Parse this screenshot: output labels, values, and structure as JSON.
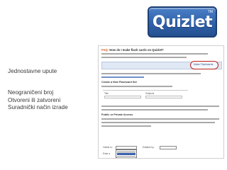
{
  "logo": {
    "text": "Quizlet",
    "tm": "TM"
  },
  "left": {
    "line1": "Jednostavne upute",
    "lines": [
      "Neograničeni broj",
      "Otvoreni ili zatvoreni",
      "Suradnički način izrade"
    ]
  },
  "faq": {
    "prefix": "FAQ:",
    "title": "How do I make flash cards on Quizlet?",
    "button": "Make Flashcards",
    "section_create": "Create a New Flashcard Set",
    "section_privacy": "Public or Private Access",
    "col_title": "Title",
    "col_tags": "Subjects",
    "visible_label": "Visible to:",
    "edit_label": "Editable by:",
    "enter_label": "Enter a"
  },
  "colors": {
    "logo_blue": "#2e5fa8",
    "highlight_red": "#c0221b",
    "faq_orange": "#d05a1e",
    "text_gray": "#3a3a3a"
  }
}
